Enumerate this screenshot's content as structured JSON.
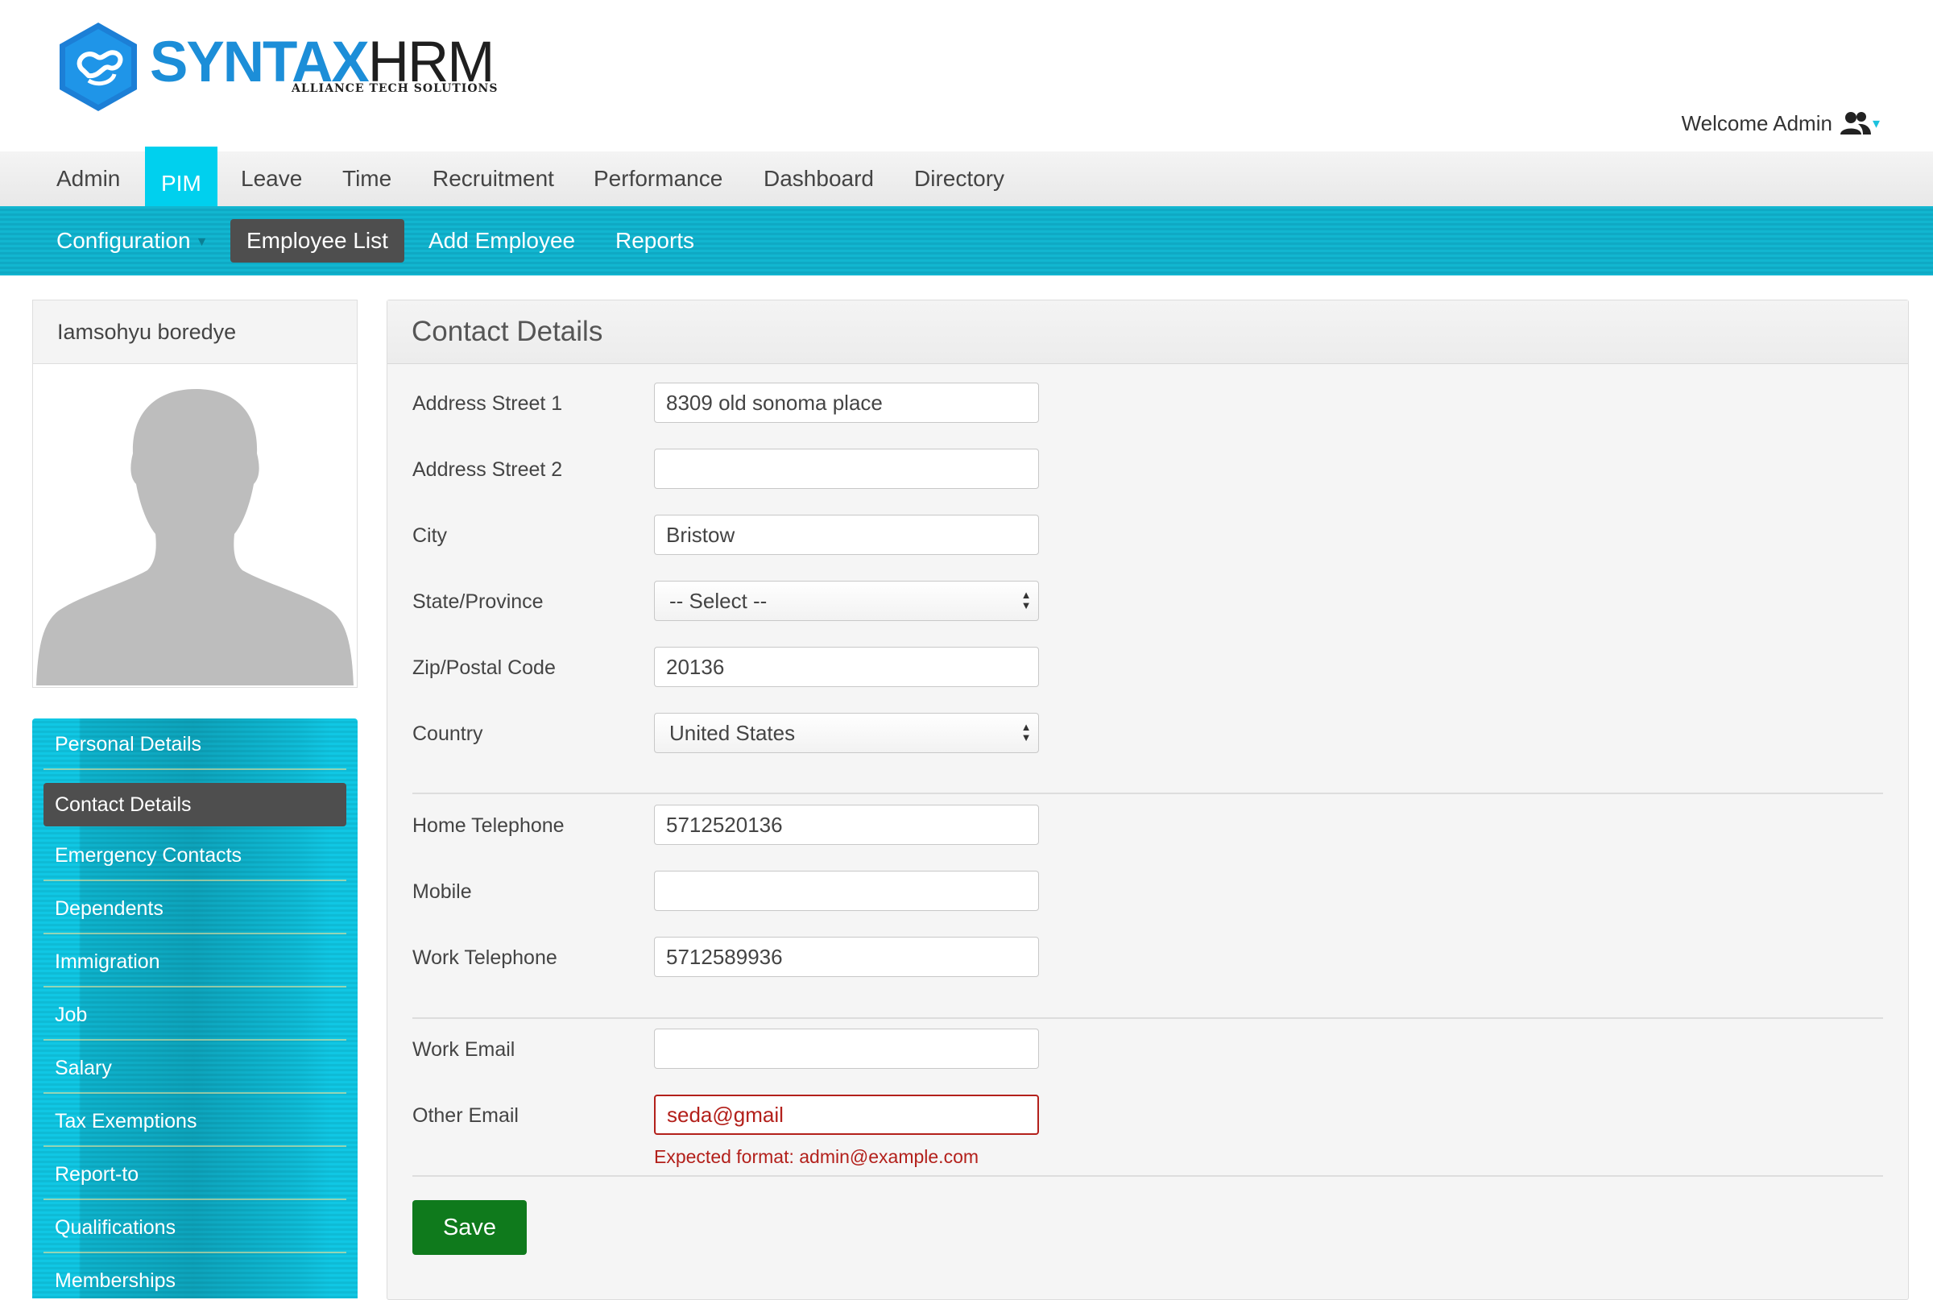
{
  "brand": {
    "name_part1": "SYNTAX",
    "name_part2": "HRM",
    "tagline": "ALLIANCE TECH SOLUTIONS",
    "colors": {
      "primary": "#1c8ed8",
      "accent": "#00d0ee"
    }
  },
  "header": {
    "welcome_text": "Welcome Admin",
    "user_icon": "users-icon",
    "dropdown_caret": "▾"
  },
  "top_menu": {
    "items": [
      {
        "label": "Admin"
      },
      {
        "label": "PIM",
        "active": true
      },
      {
        "label": "Leave"
      },
      {
        "label": "Time"
      },
      {
        "label": "Recruitment"
      },
      {
        "label": "Performance"
      },
      {
        "label": "Dashboard"
      },
      {
        "label": "Directory"
      }
    ]
  },
  "sub_menu": {
    "items": [
      {
        "label": "Configuration",
        "has_dropdown": true
      },
      {
        "label": "Employee List",
        "active": true
      },
      {
        "label": "Add Employee"
      },
      {
        "label": "Reports"
      }
    ],
    "dropdown_icon": "▼"
  },
  "profile": {
    "name": "Iamsohyu boredye",
    "avatar": "default-avatar-silhouette"
  },
  "side_menu": {
    "items": [
      {
        "label": "Personal Details"
      },
      {
        "label": "Contact Details",
        "active": true
      },
      {
        "label": "Emergency Contacts"
      },
      {
        "label": "Dependents"
      },
      {
        "label": "Immigration"
      },
      {
        "label": "Job"
      },
      {
        "label": "Salary"
      },
      {
        "label": "Tax Exemptions"
      },
      {
        "label": "Report-to"
      },
      {
        "label": "Qualifications"
      },
      {
        "label": "Memberships"
      }
    ]
  },
  "contact_form": {
    "title": "Contact Details",
    "address1": {
      "label": "Address Street 1",
      "value": "8309 old sonoma place"
    },
    "address2": {
      "label": "Address Street 2",
      "value": ""
    },
    "city": {
      "label": "City",
      "value": "Bristow"
    },
    "state": {
      "label": "State/Province",
      "value": "-- Select --"
    },
    "zip": {
      "label": "Zip/Postal Code",
      "value": "20136"
    },
    "country": {
      "label": "Country",
      "value": "United States"
    },
    "home_phone": {
      "label": "Home Telephone",
      "value": "5712520136"
    },
    "mobile": {
      "label": "Mobile",
      "value": ""
    },
    "work_phone": {
      "label": "Work Telephone",
      "value": "5712589936"
    },
    "work_email": {
      "label": "Work Email",
      "value": ""
    },
    "other_email": {
      "label": "Other Email",
      "value": "seda@gmail",
      "error": "Expected format: admin@example.com",
      "error_color": "#b3201b"
    },
    "save_label": "Save",
    "save_color": "#0f7a1c"
  }
}
